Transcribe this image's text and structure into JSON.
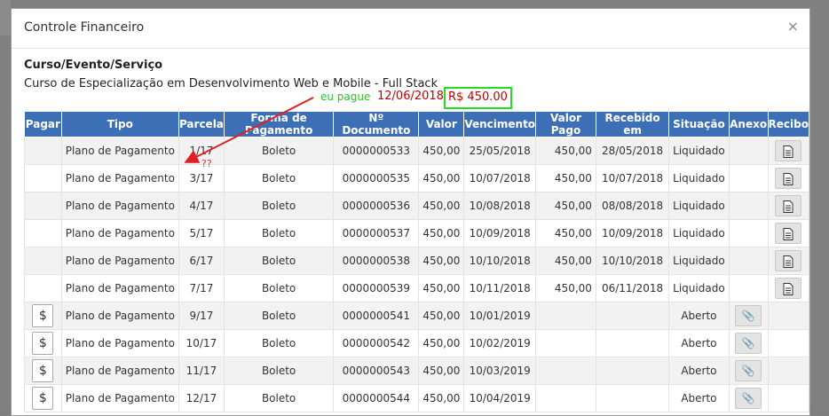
{
  "modal": {
    "title": "Controle Financeiro",
    "close_icon": "×",
    "section_label": "Curso/Evento/Serviço",
    "course_name": "Curso de Especialização em Desenvolvimento Web e Mobile - Full Stack"
  },
  "annotation": {
    "paid_text": "eu pague",
    "paid_date": "12/06/2018",
    "paid_amount": "R$ 450.00",
    "question": "??",
    "arrow_color": "#e02020",
    "box_color": "#22dd22"
  },
  "table": {
    "headers": [
      "Pagar",
      "Tipo",
      "Parcela",
      "Forma de Pagamento",
      "Nº Documento",
      "Valor",
      "Vencimento",
      "Valor Pago",
      "Recebido em",
      "Situação",
      "Anexo",
      "Recibo"
    ],
    "header_color": "#3d6fb6",
    "rows": [
      {
        "pagar": "",
        "tipo": "Plano de Pagamento",
        "parcela": "1/17",
        "forma": "Boleto",
        "doc": "0000000533",
        "valor": "450,00",
        "vencimento": "25/05/2018",
        "valor_pago": "450,00",
        "recebido": "28/05/2018",
        "situacao": "Liquidado",
        "anexo": "",
        "recibo": "document-icon"
      },
      {
        "pagar": "",
        "tipo": "Plano de Pagamento",
        "parcela": "3/17",
        "forma": "Boleto",
        "doc": "0000000535",
        "valor": "450,00",
        "vencimento": "10/07/2018",
        "valor_pago": "450,00",
        "recebido": "10/07/2018",
        "situacao": "Liquidado",
        "anexo": "",
        "recibo": "document-icon"
      },
      {
        "pagar": "",
        "tipo": "Plano de Pagamento",
        "parcela": "4/17",
        "forma": "Boleto",
        "doc": "0000000536",
        "valor": "450,00",
        "vencimento": "10/08/2018",
        "valor_pago": "450,00",
        "recebido": "08/08/2018",
        "situacao": "Liquidado",
        "anexo": "",
        "recibo": "document-icon"
      },
      {
        "pagar": "",
        "tipo": "Plano de Pagamento",
        "parcela": "5/17",
        "forma": "Boleto",
        "doc": "0000000537",
        "valor": "450,00",
        "vencimento": "10/09/2018",
        "valor_pago": "450,00",
        "recebido": "10/09/2018",
        "situacao": "Liquidado",
        "anexo": "",
        "recibo": "document-icon"
      },
      {
        "pagar": "",
        "tipo": "Plano de Pagamento",
        "parcela": "6/17",
        "forma": "Boleto",
        "doc": "0000000538",
        "valor": "450,00",
        "vencimento": "10/10/2018",
        "valor_pago": "450,00",
        "recebido": "10/10/2018",
        "situacao": "Liquidado",
        "anexo": "",
        "recibo": "document-icon"
      },
      {
        "pagar": "",
        "tipo": "Plano de Pagamento",
        "parcela": "7/17",
        "forma": "Boleto",
        "doc": "0000000539",
        "valor": "450,00",
        "vencimento": "10/11/2018",
        "valor_pago": "450,00",
        "recebido": "06/11/2018",
        "situacao": "Liquidado",
        "anexo": "",
        "recibo": "document-icon"
      },
      {
        "pagar": "$",
        "tipo": "Plano de Pagamento",
        "parcela": "9/17",
        "forma": "Boleto",
        "doc": "0000000541",
        "valor": "450,00",
        "vencimento": "10/01/2019",
        "valor_pago": "",
        "recebido": "",
        "situacao": "Aberto",
        "anexo": "paperclip-icon",
        "recibo": ""
      },
      {
        "pagar": "$",
        "tipo": "Plano de Pagamento",
        "parcela": "10/17",
        "forma": "Boleto",
        "doc": "0000000542",
        "valor": "450,00",
        "vencimento": "10/02/2019",
        "valor_pago": "",
        "recebido": "",
        "situacao": "Aberto",
        "anexo": "paperclip-icon",
        "recibo": ""
      },
      {
        "pagar": "$",
        "tipo": "Plano de Pagamento",
        "parcela": "11/17",
        "forma": "Boleto",
        "doc": "0000000543",
        "valor": "450,00",
        "vencimento": "10/03/2019",
        "valor_pago": "",
        "recebido": "",
        "situacao": "Aberto",
        "anexo": "paperclip-icon",
        "recibo": ""
      },
      {
        "pagar": "$",
        "tipo": "Plano de Pagamento",
        "parcela": "12/17",
        "forma": "Boleto",
        "doc": "0000000544",
        "valor": "450,00",
        "vencimento": "10/04/2019",
        "valor_pago": "",
        "recebido": "",
        "situacao": "Aberto",
        "anexo": "paperclip-icon",
        "recibo": ""
      }
    ]
  }
}
